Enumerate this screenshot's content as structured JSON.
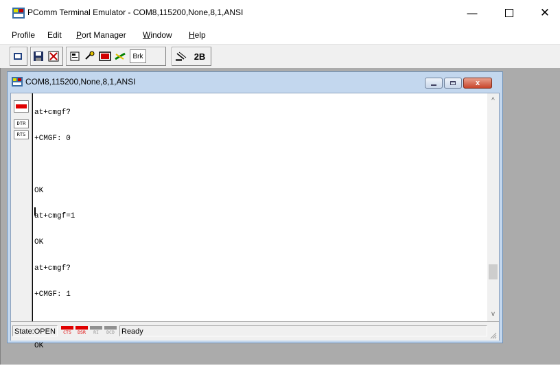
{
  "window": {
    "title": "PComm Terminal Emulator - COM8,115200,None,8,1,ANSI",
    "controls": {
      "minimize": "—",
      "close": "✕"
    }
  },
  "menu": [
    {
      "label": "Profile",
      "accel": ""
    },
    {
      "label": "Edit",
      "accel": ""
    },
    {
      "label": "Port Manager",
      "accel": "P"
    },
    {
      "label": "Window",
      "accel": "W"
    },
    {
      "label": "Help",
      "accel": "H"
    }
  ],
  "toolbar": {
    "brk_label": "Brk",
    "twob_label": "2B"
  },
  "child_window": {
    "title": "COM8,115200,None,8,1,ANSI",
    "close_glyph": "x"
  },
  "signals": {
    "dtr": "DTR",
    "rts": "RTS"
  },
  "terminal": {
    "lines": [
      "at+cmgf?",
      "+CMGF: 0",
      "",
      "OK",
      "at+cmgf=1",
      "OK",
      "at+cmgf?",
      "+CMGF: 1",
      "",
      "OK"
    ]
  },
  "scrollbar": {
    "up": "^",
    "down": "v"
  },
  "status": {
    "state": "State:OPEN",
    "indicators": [
      {
        "label": "CTS",
        "color": "#e00000"
      },
      {
        "label": "DSR",
        "color": "#e00000"
      },
      {
        "label": "RI",
        "color": "#909090"
      },
      {
        "label": "DCD",
        "color": "#909090"
      }
    ],
    "message": "Ready"
  },
  "colors": {
    "mdi_background": "#ababab",
    "child_frame": "#c3d7ee",
    "led_on": "#e00000",
    "led_off": "#909090"
  }
}
